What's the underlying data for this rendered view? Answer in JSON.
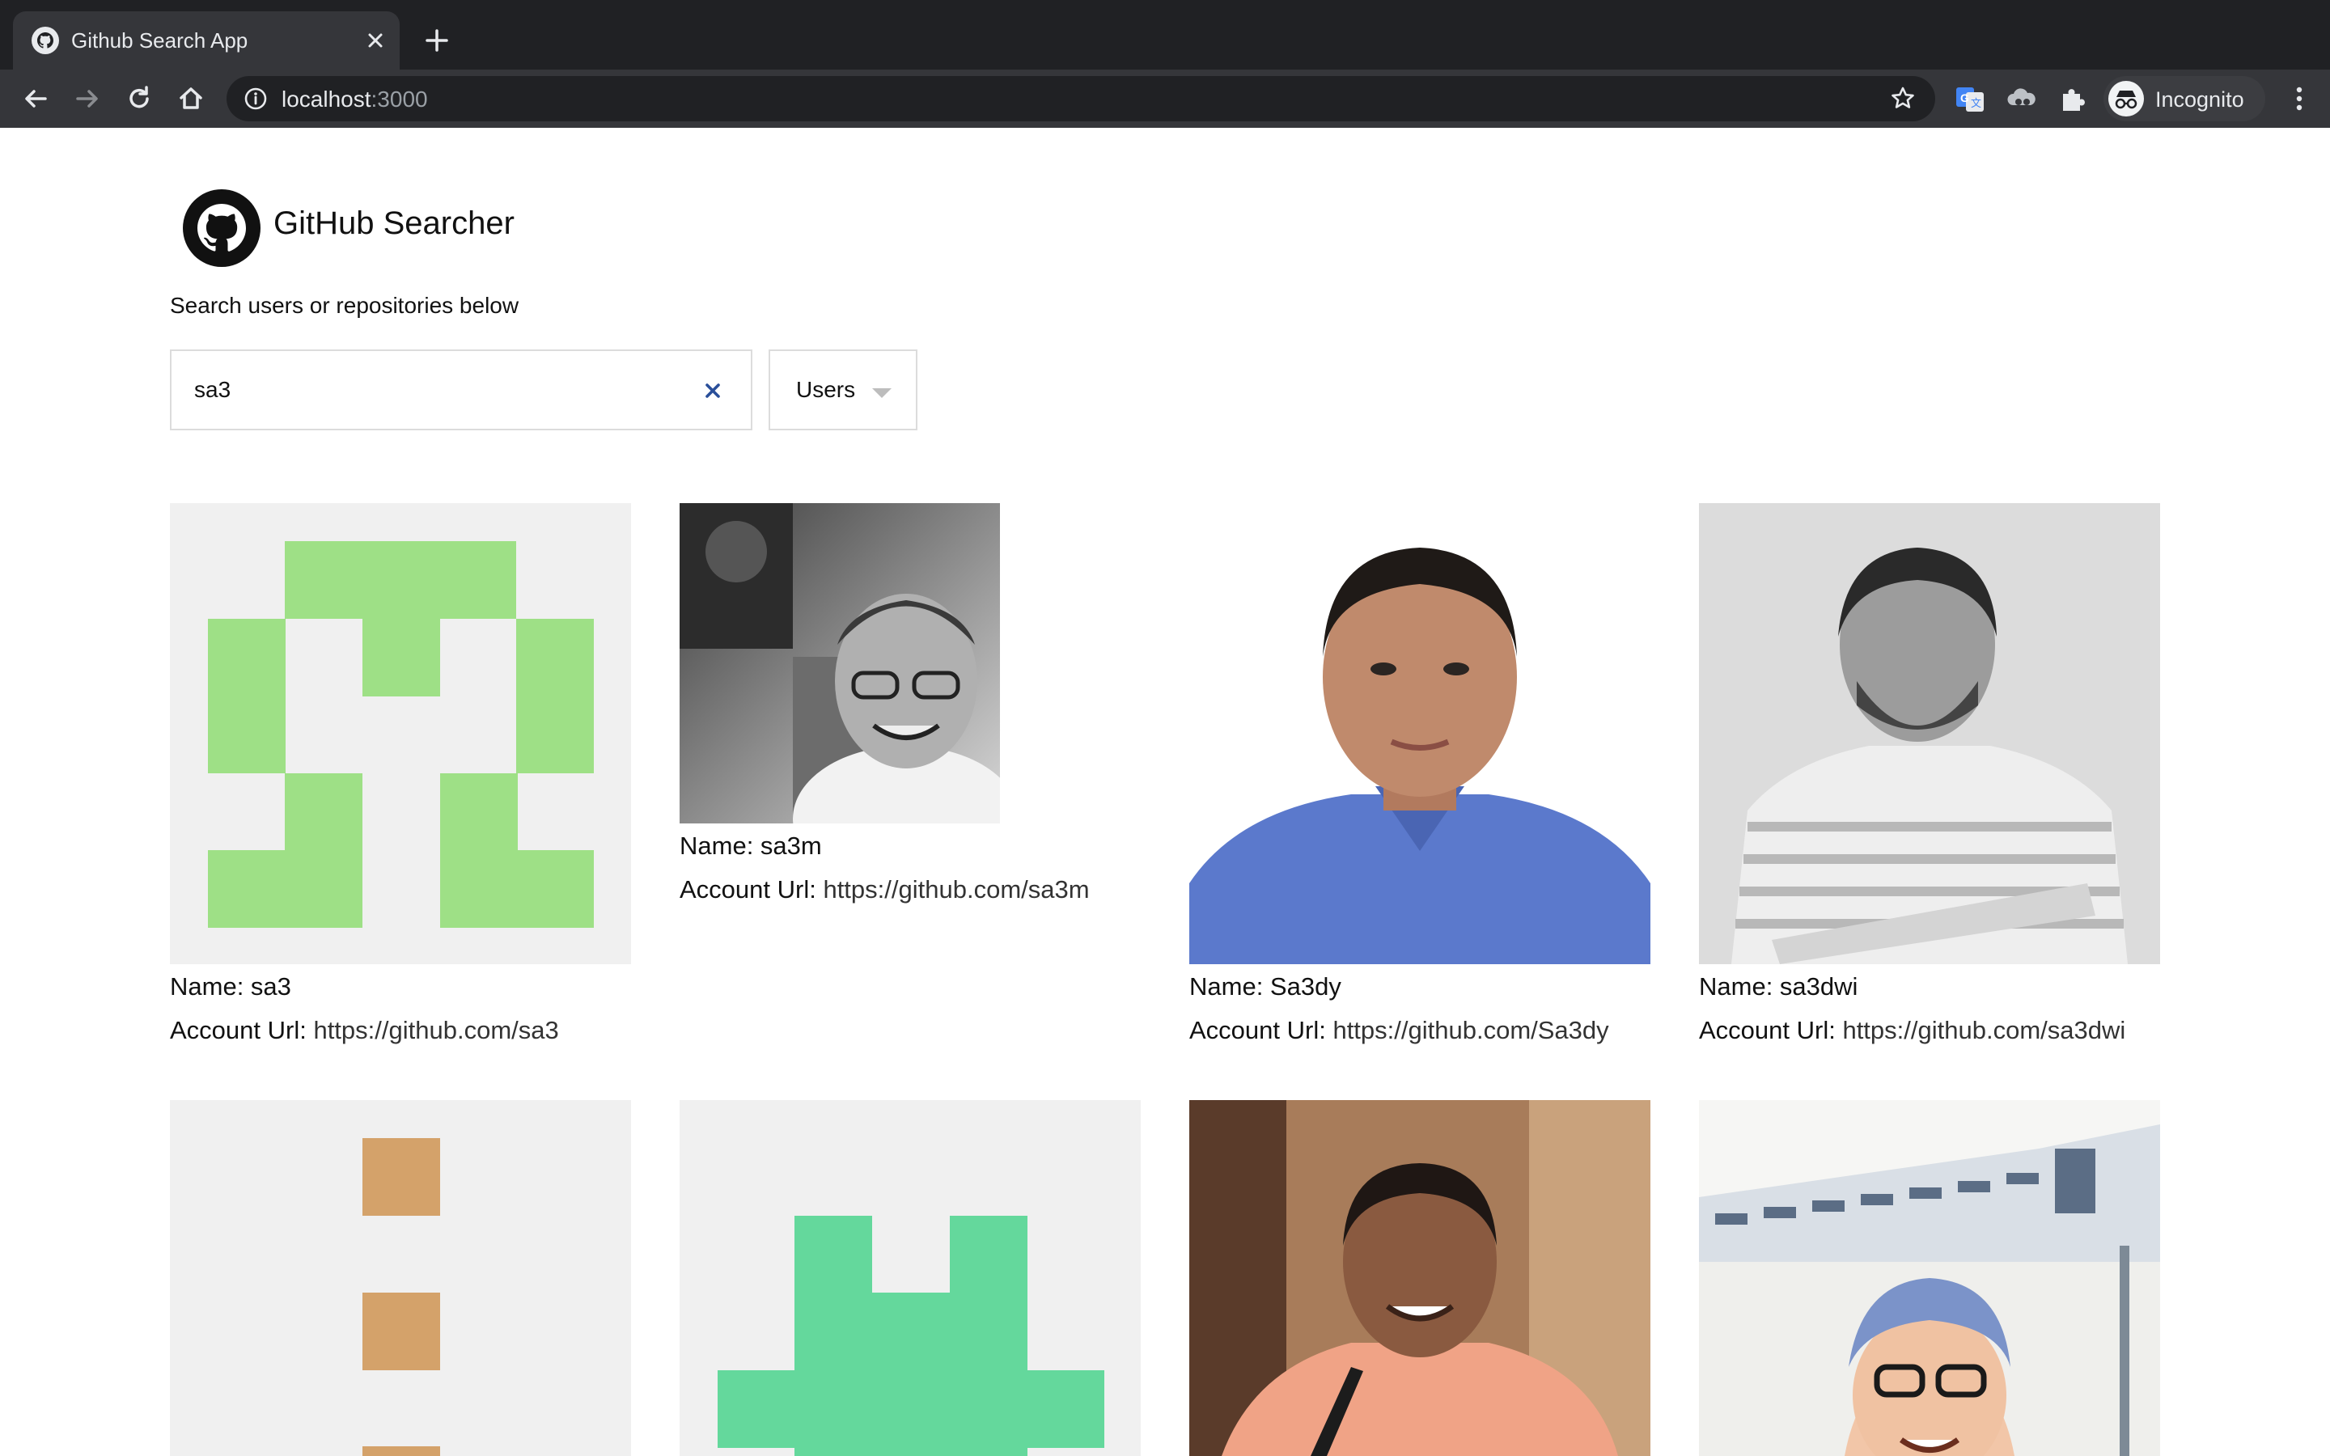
{
  "browser": {
    "tab_title": "Github Search App",
    "url_host": "localhost",
    "url_port": ":3000",
    "profile_label": "Incognito"
  },
  "app": {
    "title": "GitHub Searcher",
    "subtitle": "Search users or repositories below",
    "search_value": "sa3",
    "search_type": "Users"
  },
  "results": [
    {
      "name_prefix": "Name: ",
      "name": "sa3",
      "url_prefix": "Account Url: ",
      "url": "https://github.com/sa3",
      "avatar": "identicon-green"
    },
    {
      "name_prefix": "Name: ",
      "name": "sa3m",
      "url_prefix": "Account Url: ",
      "url": "https://github.com/sa3m",
      "avatar": "photo-bw-man-glasses"
    },
    {
      "name_prefix": "Name: ",
      "name": "Sa3dy",
      "url_prefix": "Account Url: ",
      "url": "https://github.com/Sa3dy",
      "avatar": "photo-man-blue-polo"
    },
    {
      "name_prefix": "Name: ",
      "name": "sa3dwi",
      "url_prefix": "Account Url: ",
      "url": "https://github.com/sa3dwi",
      "avatar": "photo-man-striped-shirt"
    },
    {
      "avatar": "identicon-tan"
    },
    {
      "avatar": "identicon-teal"
    },
    {
      "avatar": "photo-man-orange-shirt"
    },
    {
      "avatar": "photo-beach-selfie"
    }
  ],
  "colors": {
    "identicon_green": "#9ee086",
    "identicon_tan": "#d4a26a",
    "identicon_teal": "#64d89c",
    "identicon_bg": "#f0f0f0",
    "chrome_dark": "#202124",
    "chrome_toolbar": "#35363a"
  }
}
